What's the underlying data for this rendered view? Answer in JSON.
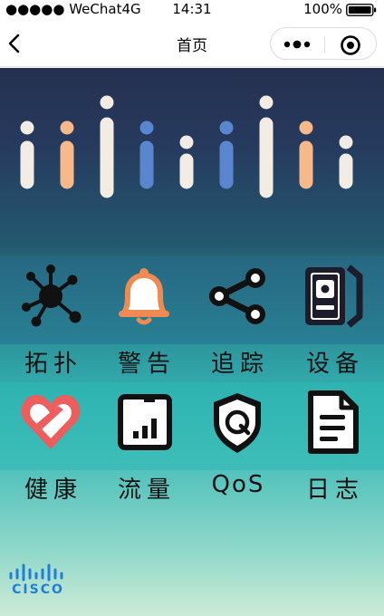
{
  "status_bar": {
    "carrier": "●●●●● WeChat4G",
    "time": "14:31",
    "battery_percent": "100%",
    "battery_icon": "battery-full-icon"
  },
  "nav": {
    "title": "首页",
    "back_icon": "chevron-left-icon",
    "more_icon": "more-dots-icon",
    "close_icon": "target-circle-icon"
  },
  "menu": {
    "row1": [
      {
        "label": "拓扑",
        "icon": "topology-icon"
      },
      {
        "label": "警告",
        "icon": "bell-icon"
      },
      {
        "label": "追踪",
        "icon": "share-trace-icon"
      },
      {
        "label": "设备",
        "icon": "device-icon"
      }
    ],
    "row2": [
      {
        "label": "健康",
        "icon": "heart-icon"
      },
      {
        "label": "流量",
        "icon": "traffic-chart-icon"
      },
      {
        "label": "QoS",
        "icon": "shield-q-icon"
      },
      {
        "label": "日志",
        "icon": "document-icon"
      }
    ]
  },
  "brand": {
    "logo_text": "CISCO",
    "logo_icon": "cisco-bars-icon"
  },
  "colors": {
    "bar_white": "#f2ece4",
    "bar_orange": "#f7b98a",
    "bar_blue": "#5a86cf",
    "bell_orange": "#ef8a52",
    "heart_red": "#ec5e5e",
    "cisco_blue": "#1f7fd6"
  }
}
